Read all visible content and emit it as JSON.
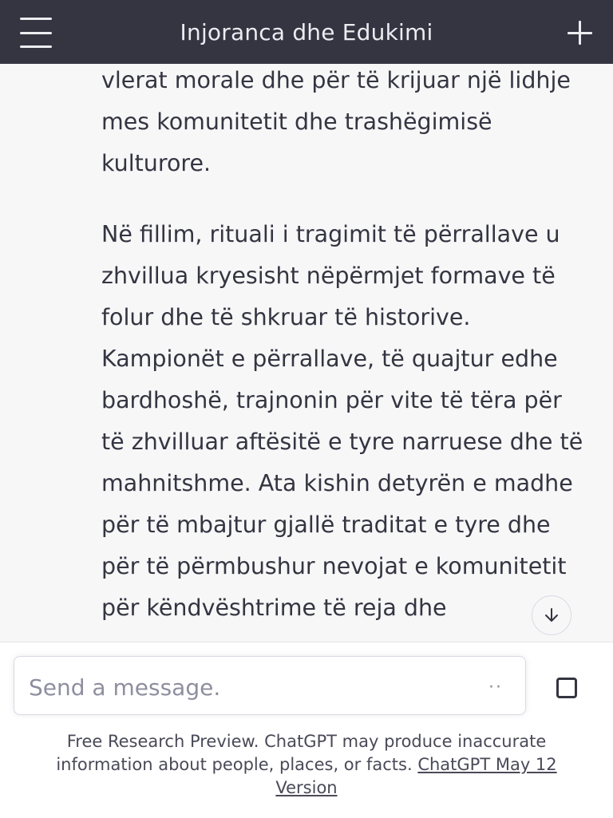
{
  "header": {
    "title": "Injoranca dhe Edukimi",
    "menu_icon": "menu-icon",
    "new_chat_icon": "plus-icon"
  },
  "conversation": {
    "paragraphs": [
      "vlerat morale dhe për të krijuar një lidhje mes komunitetit dhe trashëgimisë kulturore.",
      "Në fillim, rituali i tragimit të përrallave u zhvillua kryesisht nëpërmjet formave të folur dhe të shkruar të historive. Kampionët e përrallave, të quajtur edhe bardhoshë, trajnonin për vite të tëra për të zhvilluar aftësitë e tyre narruese dhe të mahnitshme. Ata kishin detyrën e madhe për të mbajtur gjallë traditat e tyre dhe për të përmbushur nevojat e komunitetit për këndvështrime të reja dhe"
    ],
    "scroll_down_icon": "arrow-down-icon"
  },
  "composer": {
    "placeholder": "Send a message.",
    "value": "",
    "loading_indicator": "··",
    "stop_icon": "stop-square-icon"
  },
  "footer": {
    "disclaimer": "Free Research Preview. ChatGPT may produce inaccurate information about people, places, or facts.",
    "version_link": "ChatGPT May 12 Version"
  },
  "colors": {
    "header_bg": "#343541",
    "page_bg": "#f7f7f8",
    "text": "#343541"
  }
}
